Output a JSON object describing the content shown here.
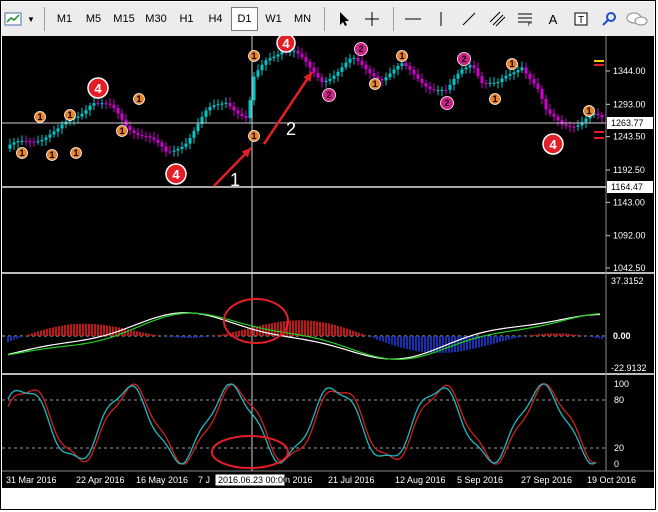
{
  "toolbar": {
    "timeframes": [
      "M1",
      "M5",
      "M15",
      "M30",
      "H1",
      "H4",
      "D1",
      "W1",
      "MN"
    ],
    "active_timeframe": "D1",
    "text_tool": "A"
  },
  "price_axis": {
    "ticks": [
      "1344.00",
      "1293.00",
      "1243.50",
      "1192.50",
      "1143.00",
      "1092.00",
      "1042.50"
    ],
    "current_price": "1263.77",
    "line_price": "1164.47"
  },
  "macd_axis": {
    "top": "37.3152",
    "zero": "0.00",
    "bottom": "-22.9132"
  },
  "stoch_axis": {
    "ticks": [
      "100",
      "80",
      "20",
      "0"
    ]
  },
  "time_axis": {
    "labels": [
      "31 Mar 2016",
      "22 Apr 2016",
      "16 May 2016",
      "7 J",
      "",
      "21 Jul 2016",
      "12 Aug 2016",
      "5 Sep 2016",
      "27 Sep 2016",
      "19 Oct 2016"
    ],
    "crosshair_date": "2016.06.23 00:00",
    "partial_label": "h 2016"
  },
  "annotations": {
    "point_1": "1",
    "point_2": "2",
    "wave_4": "4",
    "wave_2": "2",
    "wave_1": "1"
  },
  "colors": {
    "bull": "#00c8c8",
    "bear": "#d000d0",
    "red": "#e41e26",
    "orange": "#e8822a",
    "magenta": "#d0208a"
  }
}
